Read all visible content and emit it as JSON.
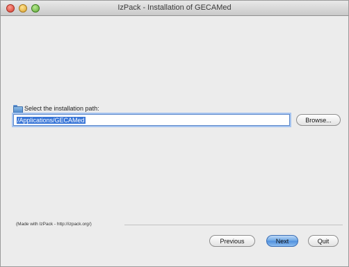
{
  "window": {
    "title": "IzPack - Installation of GECAMed"
  },
  "path_panel": {
    "label": "Select the installation path:",
    "path_value": "/Applications/GECAMed",
    "browse_label": "Browse..."
  },
  "footer": {
    "made_with": "(Made with IzPack - http://izpack.org/)",
    "previous_label": "Previous",
    "next_label": "Next",
    "quit_label": "Quit"
  },
  "colors": {
    "selection": "#3875d7",
    "focus_ring": "#a7c5f0",
    "window_bg": "#ececec"
  },
  "icons": [
    "close-icon",
    "minimize-icon",
    "zoom-icon",
    "folder-icon"
  ]
}
